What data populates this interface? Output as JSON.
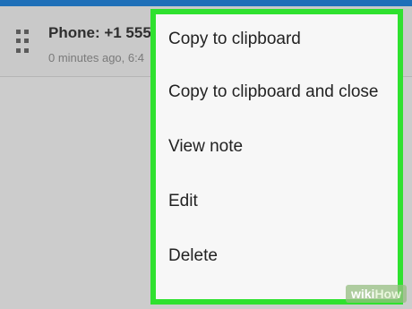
{
  "card": {
    "title": "Phone: +1 555",
    "subtitle": "0 minutes ago, 6:4"
  },
  "menu": {
    "items": [
      {
        "label": "Copy to clipboard"
      },
      {
        "label": "Copy to clipboard and close"
      },
      {
        "label": "View note"
      },
      {
        "label": "Edit"
      },
      {
        "label": "Delete"
      }
    ]
  },
  "watermark": {
    "part1": "wiki",
    "part2": "How"
  },
  "colors": {
    "highlight": "#2fe12f",
    "topbar": "#1e6fb8",
    "menu_bg": "#f7f7f7"
  },
  "icons": {
    "drag_handle": "drag-handle-icon"
  }
}
